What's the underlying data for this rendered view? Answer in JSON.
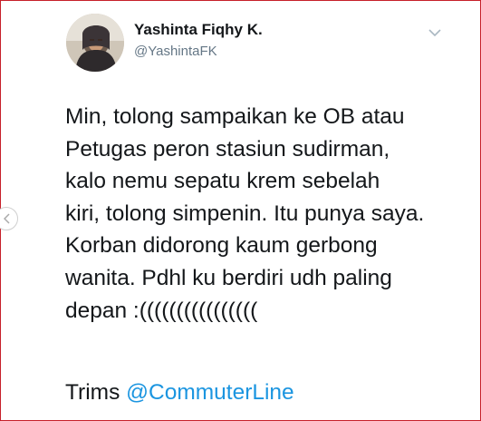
{
  "tweet": {
    "display_name": "Yashinta Fiqhy K.",
    "handle": "@YashintaFK",
    "body": "Min, tolong sampaikan ke OB atau\nPetugas peron stasiun sudirman,\nkalo nemu sepatu krem sebelah\nkiri, tolong simpenin. Itu punya saya.\nKorban didorong kaum gerbong\nwanita. Pdhl ku berdiri udh paling\ndepan :((((((((((((((((",
    "closing_text": "Trims ",
    "mention": "@CommuterLine"
  },
  "icons": {
    "menu": "chevron-down-icon",
    "nav": "chevron-left-icon",
    "avatar": "profile-avatar"
  },
  "colors": {
    "frame_border": "#c7202a",
    "text": "#14171a",
    "handle": "#657786",
    "mention": "#1b95e0"
  }
}
